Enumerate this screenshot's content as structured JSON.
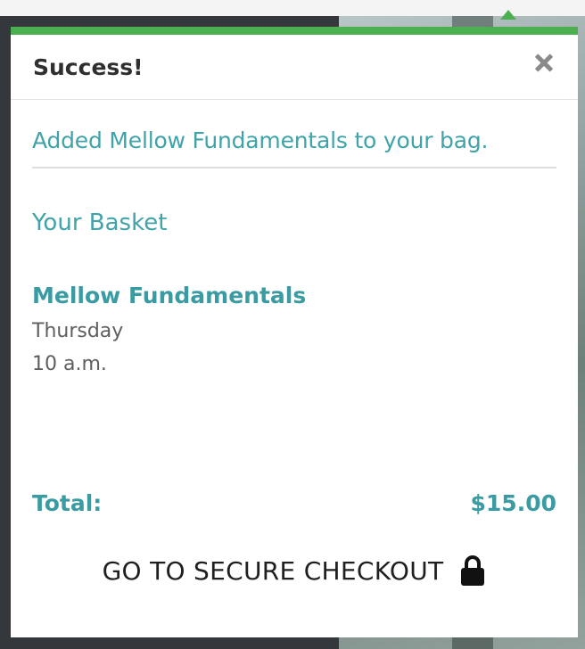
{
  "popup": {
    "title": "Success!",
    "close_icon": "close-icon",
    "accent_color": "#4caf50",
    "text_accent_color": "#3fa3a8"
  },
  "notice": {
    "added_message": "Added Mellow Fundamentals to your bag."
  },
  "basket": {
    "heading": "Your Basket",
    "items": [
      {
        "name": "Mellow Fundamentals",
        "day": "Thursday",
        "time": "10 a.m."
      }
    ],
    "total_label": "Total:",
    "total_value": "$15.00"
  },
  "checkout": {
    "label": "GO TO SECURE CHECKOUT",
    "icon": "lock-icon"
  }
}
